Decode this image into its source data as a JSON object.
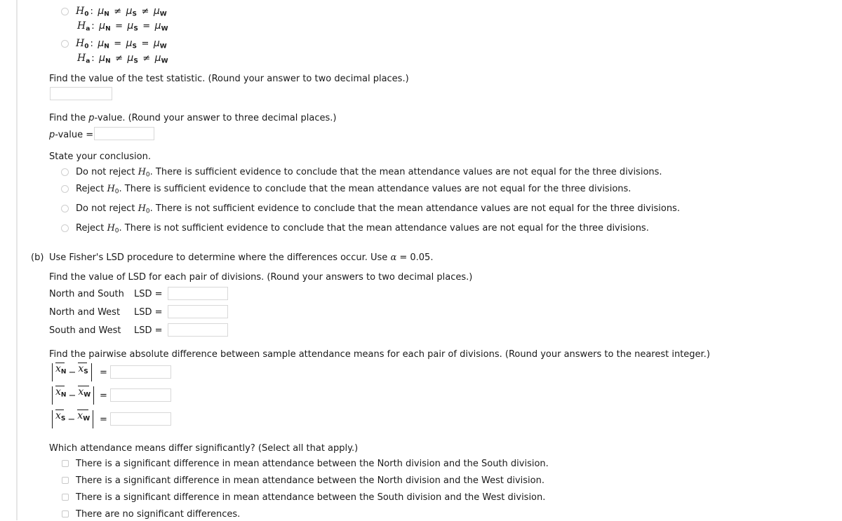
{
  "hypothesis_options": [
    {
      "h0_label": "H",
      "h0_sub": "0",
      "h0_expr": "μN ≠ μS ≠ μW",
      "ha_label": "H",
      "ha_sub": "a",
      "ha_expr": "μN = μS = μW",
      "h0_parts": [
        "N",
        "≠",
        "S",
        "≠",
        "W"
      ],
      "ha_parts": [
        "N",
        "=",
        "S",
        "=",
        "W"
      ]
    },
    {
      "h0_label": "H",
      "h0_sub": "0",
      "h0_expr": "μN = μS = μW",
      "ha_label": "H",
      "ha_sub": "a",
      "ha_expr": "μN ≠ μS ≠ μW",
      "h0_parts": [
        "N",
        "=",
        "S",
        "=",
        "W"
      ],
      "ha_parts": [
        "N",
        "≠",
        "S",
        "≠",
        "W"
      ]
    }
  ],
  "test_statistic": {
    "prompt": "Find the value of the test statistic. (Round your answer to two decimal places.)",
    "value": "",
    "placeholder": ""
  },
  "p_value": {
    "prompt_before": "Find the ",
    "prompt_italic": "p",
    "prompt_after": "-value. (Round your answer to three decimal places.)",
    "label_italic": "p",
    "label_after": "-value  =",
    "value": "",
    "placeholder": ""
  },
  "conclusion": {
    "prompt": "State your conclusion.",
    "options": [
      {
        "lead": "Do not reject ",
        "h": "H",
        "hsub": "0",
        "rest": ". There is sufficient evidence to conclude that the mean attendance values are not equal for the three divisions.",
        "selected": false
      },
      {
        "lead": "Reject ",
        "h": "H",
        "hsub": "0",
        "rest": ". There is sufficient evidence to conclude that the mean attendance values are not equal for the three divisions.",
        "selected": false
      },
      {
        "lead": "Do not reject ",
        "h": "H",
        "hsub": "0",
        "rest": ". There is not sufficient evidence to conclude that the mean attendance values are not equal for the three divisions.",
        "selected": false
      },
      {
        "lead": "Reject ",
        "h": "H",
        "hsub": "0",
        "rest": ". There is not sufficient evidence to conclude that the mean attendance values are not equal for the three divisions.",
        "selected": false
      }
    ]
  },
  "part_b": {
    "marker": "(b)",
    "intro_before": "Use Fisher's LSD procedure to determine where the differences occur. Use ",
    "intro_alpha": "α",
    "intro_after": " = 0.05.",
    "lsd_prompt": "Find the value of LSD for each pair of divisions. (Round your answers to two decimal places.)",
    "lsd_rows": [
      {
        "pair": "North and South",
        "label": "LSD  =",
        "value": "",
        "placeholder": ""
      },
      {
        "pair": "North and West",
        "label": "LSD  =",
        "value": "",
        "placeholder": ""
      },
      {
        "pair": "South and West",
        "label": "LSD  =",
        "value": "",
        "placeholder": ""
      }
    ],
    "diff_prompt": "Find the pairwise absolute difference between sample attendance means for each pair of divisions. (Round your answers to the nearest integer.)",
    "diff_rows": [
      {
        "sub_a": "N",
        "sub_b": "S",
        "eq": "=",
        "value": "",
        "placeholder": ""
      },
      {
        "sub_a": "N",
        "sub_b": "W",
        "eq": "=",
        "value": "",
        "placeholder": ""
      },
      {
        "sub_a": "S",
        "sub_b": "W",
        "eq": "=",
        "value": "",
        "placeholder": ""
      }
    ],
    "select_prompt": "Which attendance means differ significantly? (Select all that apply.)",
    "select_options": [
      {
        "text": "There is a significant difference in mean attendance between the North division and the South division.",
        "checked": false
      },
      {
        "text": "There is a significant difference in mean attendance between the North division and the West division.",
        "checked": false
      },
      {
        "text": "There is a significant difference in mean attendance between the South division and the West division.",
        "checked": false
      },
      {
        "text": "There are no significant differences.",
        "checked": false
      }
    ]
  },
  "colors": {
    "text": "#1a1a1a",
    "field_border": "#d8d8d8",
    "control_border": "#cfcfcf",
    "rule": "#e6e6e6"
  }
}
